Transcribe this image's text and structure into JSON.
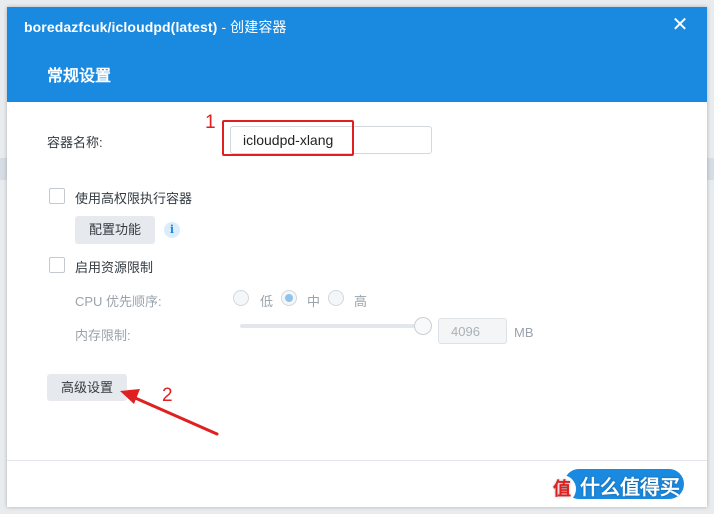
{
  "window": {
    "title_repo": "boredazfcuk/icloudpd(latest)",
    "title_sep": " - ",
    "title_action": "创建容器",
    "close_glyph": "✕"
  },
  "section": {
    "title": "常规设置"
  },
  "form": {
    "container_name_label": "容器名称:",
    "container_name_value": "icloudpd-xlang",
    "privileged_label": "使用高权限执行容器",
    "configure_button": "配置功能",
    "info_glyph": "i",
    "resource_limit_label": "启用资源限制",
    "cpu_priority_label": "CPU 优先顺序:",
    "cpu_options": [
      "低",
      "中",
      "高"
    ],
    "cpu_selected": "中",
    "memory_label": "内存限制:",
    "memory_value": "4096",
    "memory_unit": "MB",
    "advanced_button": "高级设置"
  },
  "annotations": {
    "marker_1": "1",
    "marker_2": "2"
  },
  "watermark": {
    "logo_glyph": "值",
    "text": "什么值得买"
  },
  "colors": {
    "accent": "#1a8ae0",
    "annotation": "#e02020"
  },
  "icons": [
    "close-icon",
    "info-icon",
    "arrow-annotation-icon"
  ]
}
